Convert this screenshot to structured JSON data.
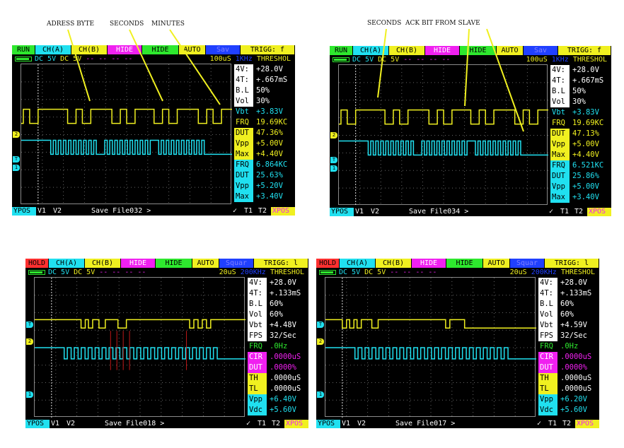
{
  "annotations": {
    "adress_byte": "ADRESS BYTE",
    "seconds_1": "SECONDS",
    "minutes": "MINUTES",
    "seconds_2": "SECONDS",
    "ack_bit": "ACK BIT FROM SLAVE"
  },
  "colors": {
    "yellow": "#f0f020",
    "cyan": "#20e0f0",
    "green": "#2ee82e",
    "magenta": "#f020f0",
    "red": "#ff3030",
    "blue": "#2040ff",
    "white": "#ffffff"
  },
  "scopes": [
    {
      "top": {
        "mode": "RUN",
        "cha": "CH(A)",
        "chb": "CH(B)",
        "hide1": "HIDE",
        "hide2": "HIDE",
        "auto": "AUTO",
        "save": "Sav",
        "trigg": "TRIGG: f"
      },
      "second": {
        "cha": "DC 5V",
        "chb": "DC 5V",
        "dash": "-- -- -- --",
        "time": "100uS",
        "freq": "1KHz",
        "thr": "THRESHOL"
      },
      "meas": [
        {
          "label": "4V:",
          "value": "+28.0V"
        },
        {
          "label": "4T:",
          "value": "+.667mS"
        },
        {
          "label": "B.L",
          "value": "50%"
        },
        {
          "label": "Vol",
          "value": "30%"
        },
        {
          "label": "Vbt",
          "value": "+3.83V"
        },
        {
          "label": "FRQ",
          "value": "19.69KC"
        },
        {
          "label": "DUT",
          "value": "47.36%"
        },
        {
          "label": "Vpp",
          "value": "+5.00V"
        },
        {
          "label": "Max",
          "value": "+4.40V"
        },
        {
          "label": "FRQ",
          "value": "6.864KC"
        },
        {
          "label": "DUT",
          "value": "25.63%"
        },
        {
          "label": "Vpp",
          "value": "+5.20V"
        },
        {
          "label": "Max",
          "value": "+3.40V"
        }
      ],
      "bottom": {
        "ypos": "YPOS",
        "v1": "V1",
        "v2": "V2",
        "save": "Save File032 >",
        "check": "✓",
        "t1": "T1",
        "t2": "T2",
        "xpos": "XPOS"
      }
    },
    {
      "top": {
        "mode": "RUN",
        "cha": "CH(A)",
        "chb": "CH(B)",
        "hide1": "HIDE",
        "hide2": "HIDE",
        "auto": "AUTO",
        "save": "Sav",
        "trigg": "TRIGG: f"
      },
      "second": {
        "cha": "DC 5V",
        "chb": "DC 5V",
        "dash": "-- -- -- --",
        "time": "100uS",
        "freq": "1KHz",
        "thr": "THRESHOL"
      },
      "meas": [
        {
          "label": "4V:",
          "value": "+28.0V"
        },
        {
          "label": "4T:",
          "value": "+.667mS"
        },
        {
          "label": "B.L",
          "value": "50%"
        },
        {
          "label": "Vol",
          "value": "30%"
        },
        {
          "label": "Vbt",
          "value": "+3.83V"
        },
        {
          "label": "FRQ",
          "value": "19.69KC"
        },
        {
          "label": "DUT",
          "value": "47.13%"
        },
        {
          "label": "Vpp",
          "value": "+5.00V"
        },
        {
          "label": "Max",
          "value": "+4.40V"
        },
        {
          "label": "FRQ",
          "value": "6.521KC"
        },
        {
          "label": "DUT",
          "value": "25.86%"
        },
        {
          "label": "Vpp",
          "value": "+5.00V"
        },
        {
          "label": "Max",
          "value": "+3.40V"
        }
      ],
      "bottom": {
        "ypos": "YPOS",
        "v1": "V1",
        "v2": "V2",
        "save": "Save File034 >",
        "check": "✓",
        "t1": "T1",
        "t2": "T2",
        "xpos": "XPOS"
      }
    },
    {
      "top": {
        "mode": "HOLD",
        "cha": "CH(A)",
        "chb": "CH(B)",
        "hide1": "HIDE",
        "hide2": "HIDE",
        "auto": "AUTO",
        "save": "Squar",
        "trigg": "TRIGG: l"
      },
      "second": {
        "cha": "DC 5V",
        "chb": "DC 5V",
        "dash": "-- -- -- --",
        "time": "20uS",
        "freq": "200KHz",
        "thr": "THRESHOL"
      },
      "meas": [
        {
          "label": "4V:",
          "value": "+28.0V"
        },
        {
          "label": "4T:",
          "value": "+.133mS"
        },
        {
          "label": "B.L",
          "value": "60%"
        },
        {
          "label": "Vol",
          "value": "60%"
        },
        {
          "label": "Vbt",
          "value": "+4.48V"
        },
        {
          "label": "FPS",
          "value": "32/Sec"
        },
        {
          "label": "FRQ",
          "value": ".0Hz"
        },
        {
          "label": "CIR",
          "value": ".0000uS"
        },
        {
          "label": "DUT",
          "value": ".0000%"
        },
        {
          "label": "TH",
          "value": ".0000uS"
        },
        {
          "label": "TL",
          "value": ".0000uS"
        },
        {
          "label": "Vpp",
          "value": "+6.40V"
        },
        {
          "label": "Vdc",
          "value": "+5.60V"
        }
      ],
      "bottom": {
        "ypos": "YPOS",
        "v1": "V1",
        "v2": "V2",
        "save": "Save File018 >",
        "check": "✓",
        "t1": "T1",
        "t2": "T2",
        "xpos": "XPOS"
      }
    },
    {
      "top": {
        "mode": "HOLD",
        "cha": "CH(A)",
        "chb": "CH(B)",
        "hide1": "HIDE",
        "hide2": "HIDE",
        "auto": "AUTO",
        "save": "Squar",
        "trigg": "TRIGG: l"
      },
      "second": {
        "cha": "DC 5V",
        "chb": "DC 5V",
        "dash": "-- -- -- --",
        "time": "20uS",
        "freq": "200KHz",
        "thr": "THRESHOL"
      },
      "meas": [
        {
          "label": "4V:",
          "value": "+28.0V"
        },
        {
          "label": "4T:",
          "value": "+.133mS"
        },
        {
          "label": "B.L",
          "value": "60%"
        },
        {
          "label": "Vol",
          "value": "60%"
        },
        {
          "label": "Vbt",
          "value": "+4.59V"
        },
        {
          "label": "FPS",
          "value": "32/Sec"
        },
        {
          "label": "FRQ",
          "value": ".0Hz"
        },
        {
          "label": "CIR",
          "value": ".0000uS"
        },
        {
          "label": "DUT",
          "value": ".0000%"
        },
        {
          "label": "TH",
          "value": ".0000uS"
        },
        {
          "label": "TL",
          "value": ".0000uS"
        },
        {
          "label": "Vpp",
          "value": "+6.20V"
        },
        {
          "label": "Vdc",
          "value": "+5.60V"
        }
      ],
      "bottom": {
        "ypos": "YPOS",
        "v1": "V1",
        "v2": "V2",
        "save": "Save File017 >",
        "check": "✓",
        "t1": "T1",
        "t2": "T2",
        "xpos": "XPOS"
      }
    }
  ]
}
